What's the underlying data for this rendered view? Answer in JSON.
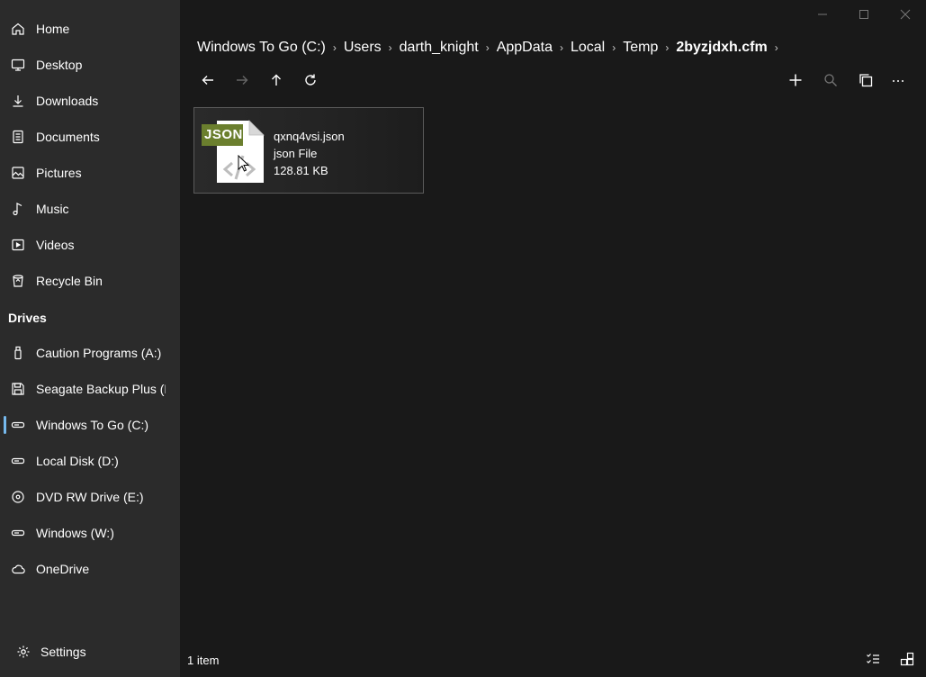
{
  "sidebar": {
    "items": [
      {
        "label": "Home",
        "icon": "home-icon"
      },
      {
        "label": "Desktop",
        "icon": "desktop-icon"
      },
      {
        "label": "Downloads",
        "icon": "download-icon"
      },
      {
        "label": "Documents",
        "icon": "document-icon"
      },
      {
        "label": "Pictures",
        "icon": "picture-icon"
      },
      {
        "label": "Music",
        "icon": "music-icon"
      },
      {
        "label": "Videos",
        "icon": "video-icon"
      },
      {
        "label": "Recycle Bin",
        "icon": "recycle-bin-icon"
      }
    ],
    "drives_header": "Drives",
    "drives": [
      {
        "label": "Caution Programs (A:)",
        "icon": "usb-drive-icon"
      },
      {
        "label": "Seagate Backup Plus (B:)",
        "icon": "save-drive-icon"
      },
      {
        "label": "Windows To Go (C:)",
        "icon": "hard-drive-icon",
        "active": true
      },
      {
        "label": "Local Disk (D:)",
        "icon": "hard-drive-icon"
      },
      {
        "label": "DVD RW Drive (E:)",
        "icon": "disc-icon"
      },
      {
        "label": "Windows (W:)",
        "icon": "hard-drive-icon"
      },
      {
        "label": "OneDrive",
        "icon": "cloud-icon"
      }
    ],
    "settings_label": "Settings"
  },
  "breadcrumb": [
    "Windows To Go (C:)",
    "Users",
    "darth_knight",
    "AppData",
    "Local",
    "Temp",
    "2byzjdxh.cfm"
  ],
  "file": {
    "name": "qxnq4vsi.json",
    "type": "json File",
    "size": "128.81 KB",
    "badge": "JSON"
  },
  "status": {
    "count": "1 item"
  },
  "colors": {
    "sidebar_bg": "#2b2b2b",
    "content_bg": "#191919",
    "accent": "#76b9ed",
    "json_badge": "#6b7f2e"
  }
}
